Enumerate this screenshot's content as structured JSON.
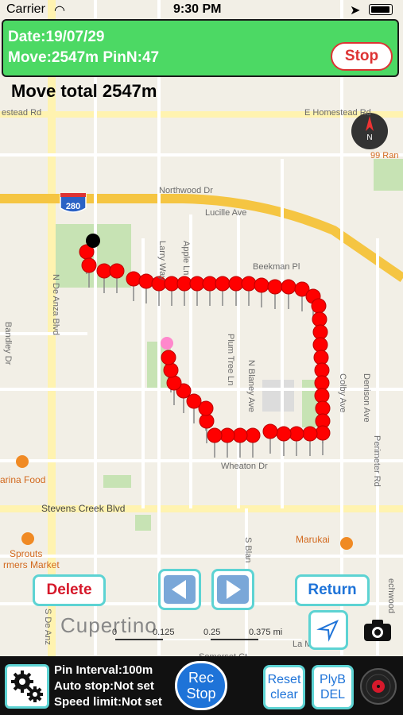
{
  "status_bar": {
    "carrier": "Carrier",
    "time": "9:30 PM"
  },
  "info_panel": {
    "date": "Date:19/07/29",
    "move": "Move:2547m PinN:47",
    "stop_label": "Stop"
  },
  "move_total": "Move total 2547m",
  "map": {
    "labels": {
      "homestead_left": "estead Rd",
      "homestead_right": "E Homestead Rd",
      "northwood": "Northwood Dr",
      "lucille": "Lucille Ave",
      "beekman": "Beekman Pl",
      "de_anza": "N De Anza Blvd",
      "bandley": "Bandley Dr",
      "larry": "Larry Way",
      "apple": "Apple Ln",
      "plum": "Plum Tree Ln",
      "blaney": "N Blaney Ave",
      "colby": "Colby Ave",
      "denison": "Denison Ave",
      "perimeter": "Perimeter Rd",
      "wheaton": "Wheaton Dr",
      "stevens_creek": "Stevens Creek Blvd",
      "farina": "arina Food",
      "marukai": "Marukai",
      "sprouts": "Sprouts",
      "farmers": "rmers Market",
      "cupertino": "Cupertino",
      "ninetynine": "99 Ran",
      "hwy": "280",
      "s_blaney": "S Blan",
      "s_de_anza": "S De Anz",
      "la_mar": "La Mar",
      "somerset": "Somerset Ct",
      "echwood": "echwood"
    },
    "scale": {
      "zero": "0",
      "t1": "0.125",
      "t2": "0.25",
      "t3": "0.375 mi"
    },
    "colors": {
      "pin": "#ff0000",
      "start_pin": "#000000",
      "end_pin": "#ff88cc",
      "highway": "#f5c542",
      "park": "#c7e3b4"
    }
  },
  "controls": {
    "delete_label": "Delete",
    "return_label": "Return",
    "prev_icon": "left-arrow-icon",
    "next_icon": "right-arrow-icon",
    "location_icon": "location-arrow-icon",
    "camera_icon": "camera-icon"
  },
  "bottom_bar": {
    "pin_interval": "Pin Interval:100m",
    "auto_stop": "Auto stop:Not set",
    "speed_limit": "Speed limit:Not set",
    "rec_line1": "Rec",
    "rec_line2": "Stop",
    "reset_line1": "Reset",
    "reset_line2": "clear",
    "plyb_line1": "PlyB",
    "plyb_line2": "DEL",
    "settings_icon": "gear-icon",
    "record_icon": "record-disc-icon"
  }
}
